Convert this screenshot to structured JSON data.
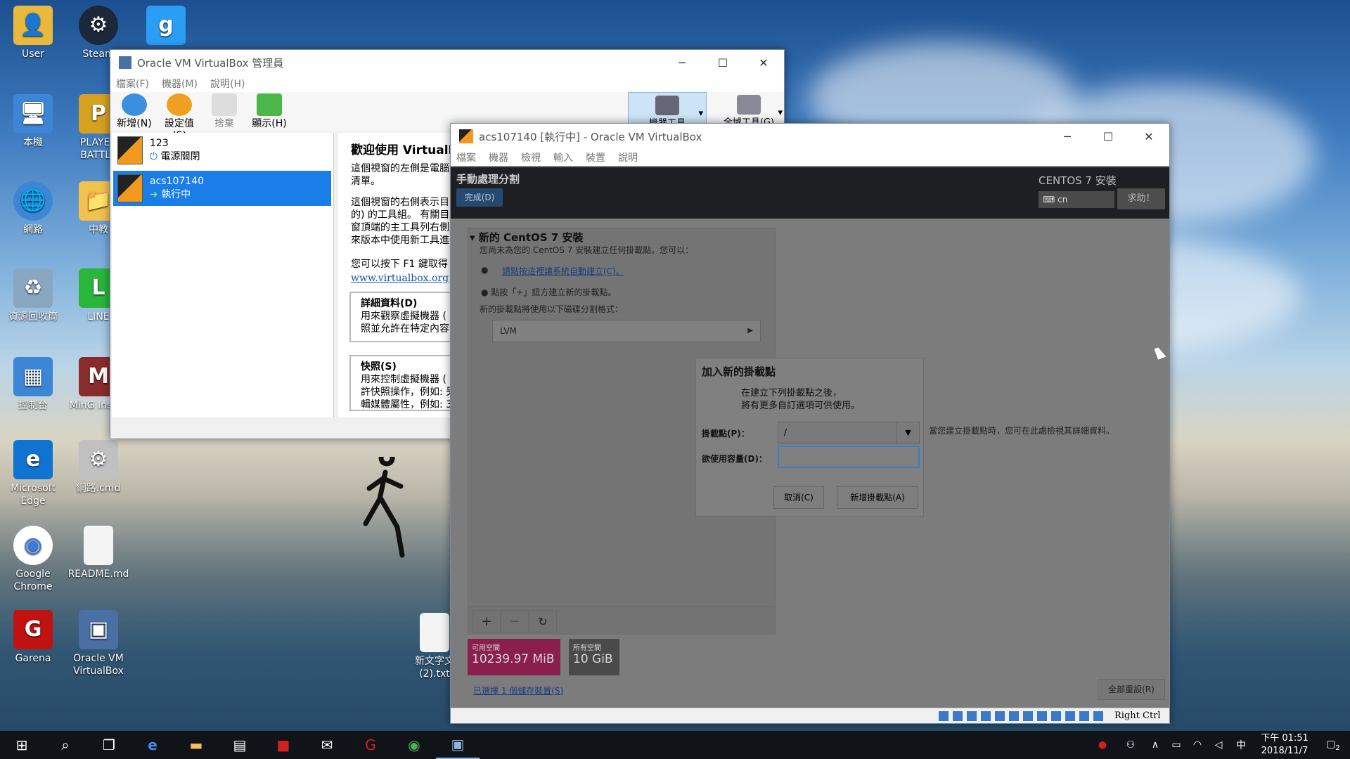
{
  "desktop": {
    "icons": [
      {
        "label": "User",
        "color": "#e8b93c",
        "glyph": "👤"
      },
      {
        "label": "Steam",
        "color": "#1b2838",
        "glyph": "⚙"
      },
      {
        "label": "g",
        "color": "#2a9df4",
        "glyph": "g"
      },
      {
        "label": "本機",
        "color": "#3d86d6",
        "glyph": "🖥"
      },
      {
        "label": "PLAYER BATTLE",
        "color": "#d6a021",
        "glyph": "P"
      },
      {
        "label": "網路",
        "color": "#3d86d6",
        "glyph": "🌐"
      },
      {
        "label": "中教",
        "color": "#f2c24e",
        "glyph": "📁"
      },
      {
        "label": "資源回收筒",
        "color": "#8aa7c2",
        "glyph": "♻"
      },
      {
        "label": "LINE",
        "color": "#2ab53b",
        "glyph": "L"
      },
      {
        "label": "控制台",
        "color": "#3d86d6",
        "glyph": "▦"
      },
      {
        "label": "MinG Install",
        "color": "#8a2c2c",
        "glyph": "M"
      },
      {
        "label": "Microsoft Edge",
        "color": "#1173d1",
        "glyph": "e"
      },
      {
        "label": "網路.cmd",
        "color": "#c0c0c0",
        "glyph": "⚙"
      },
      {
        "label": "Google Chrome",
        "color": "#e8e8e8",
        "glyph": "◉"
      },
      {
        "label": "README.md",
        "color": "#f4f4f4",
        "glyph": ""
      },
      {
        "label": "Garena",
        "color": "#c11212",
        "glyph": "G"
      },
      {
        "label": "Oracle VM VirtualBox",
        "color": "#4a6fa5",
        "glyph": "▣"
      },
      {
        "label": "新文字文(2).txt",
        "color": "#f4f4f4",
        "glyph": ""
      }
    ]
  },
  "manager": {
    "title": "Oracle VM VirtualBox 管理員",
    "menu": [
      "檔案(F)",
      "機器(M)",
      "說明(H)"
    ],
    "toolbar": [
      "新增(N)",
      "設定值(S)",
      "捨棄",
      "顯示(H)"
    ],
    "right_tools": [
      "機器工具",
      "全域工具(G)"
    ],
    "vms": [
      {
        "name": "123",
        "state": "電源關閉"
      },
      {
        "name": "acs107140",
        "state": "執行中"
      }
    ],
    "welcome_title": "歡迎使用 VirtualB",
    "welcome_p1": "這個視窗的左側是電腦\n清單。",
    "welcome_p2": "這個視窗的右側表示目\n的) 的工具組。 有關目\n窗頂端的主工具列右側\n來版本中使用新工具進",
    "welcome_p3": "您可以按下 F1 鍵取得",
    "welcome_link": "www.virtualbox.org",
    "welcome_link_tail": "取得",
    "details_title": "詳細資料(D)",
    "details_text": "用來觀察虛擬機器 (\n照並允許在特定內容",
    "snap_title": "快照(S)",
    "snap_text": "用來控制虛擬機器 (\n許快照操作，例如: 另\n輯媒體屬性，例如: 3"
  },
  "vmwin": {
    "title": "acs107140 [執行中] - Oracle VM VirtualBox",
    "menu": [
      "檔案",
      "機器",
      "檢視",
      "輸入",
      "裝置",
      "說明"
    ],
    "header_title": "手動處理分割",
    "done": "完成(D)",
    "centos": "CENTOS 7 安裝",
    "kbd": "cn",
    "help": "求助！",
    "section": "新的 CentOS 7 安裝",
    "no_mount": "您尚未為您的 CentOS 7 安裝建立任何掛載點。您可以：",
    "auto_link": "請點按這裡讓系統自動建立(C)。",
    "plus_hint": "點按「+」鈕方建立新的掛載點。",
    "scheme_hint": "新的掛載點將使用以下磁碟分割格式：",
    "scheme": "LVM",
    "right_hint": "當您建立掛載點時，您可在此處檢視其詳細資料。",
    "avail_label": "可用空間",
    "avail_value": "10239.97 MiB",
    "total_label": "所有空間",
    "total_value": "10 GiB",
    "storage_link": "已選擇 1 個儲存裝置(S)",
    "reset": "全部重設(R)",
    "host_key": "Right Ctrl"
  },
  "dialog": {
    "title": "加入新的掛載點",
    "desc1": "在建立下列掛載點之後，",
    "desc2": "將有更多自訂選項可供使用。",
    "mount_label": "掛載點(P)：",
    "mount_value": "/",
    "cap_label": "欲使用容量(D)：",
    "cap_value": "",
    "cancel": "取消(C)",
    "add": "新增掛載點(A)"
  },
  "taskbar": {
    "time": "下午 01:51",
    "date": "2018/11/7",
    "ime": "中",
    "notif": "2"
  }
}
